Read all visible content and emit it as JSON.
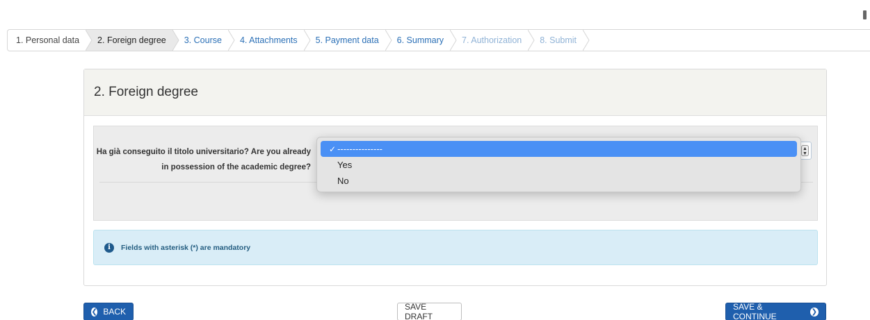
{
  "steps": [
    {
      "label": "1. Personal data",
      "state": "done"
    },
    {
      "label": "2. Foreign degree",
      "state": "active"
    },
    {
      "label": "3. Course",
      "state": "link"
    },
    {
      "label": "4. Attachments",
      "state": "link"
    },
    {
      "label": "5. Payment data",
      "state": "link"
    },
    {
      "label": "6. Summary",
      "state": "link"
    },
    {
      "label": "7. Authorization",
      "state": "disabled"
    },
    {
      "label": "8. Submit",
      "state": "disabled"
    }
  ],
  "card": {
    "title": "2. Foreign degree"
  },
  "question": {
    "label_line1": "Ha già conseguito il titolo universitario? Are you already",
    "label_line2": "in possession of the academic degree?",
    "select_value": "---------------",
    "options": [
      {
        "label": "---------------",
        "selected": true
      },
      {
        "label": "Yes",
        "selected": false
      },
      {
        "label": "No",
        "selected": false
      }
    ]
  },
  "info": {
    "text": "Fields with asterisk (*) are mandatory"
  },
  "footer": {
    "back_label": "BACK",
    "draft_label": "SAVE DRAFT",
    "next_label": "SAVE & CONTINUE"
  },
  "icons": {
    "info": "info-circle-icon",
    "back": "arrow-left-circle-icon",
    "next": "arrow-right-circle-icon",
    "check": "checkmark-icon"
  },
  "colors": {
    "primary": "#1f5fad",
    "link": "#2a6fb6",
    "disabled_link": "#8fb2d6",
    "info_bg": "#d9edf7",
    "dropdown_highlight": "#4a90f5"
  }
}
